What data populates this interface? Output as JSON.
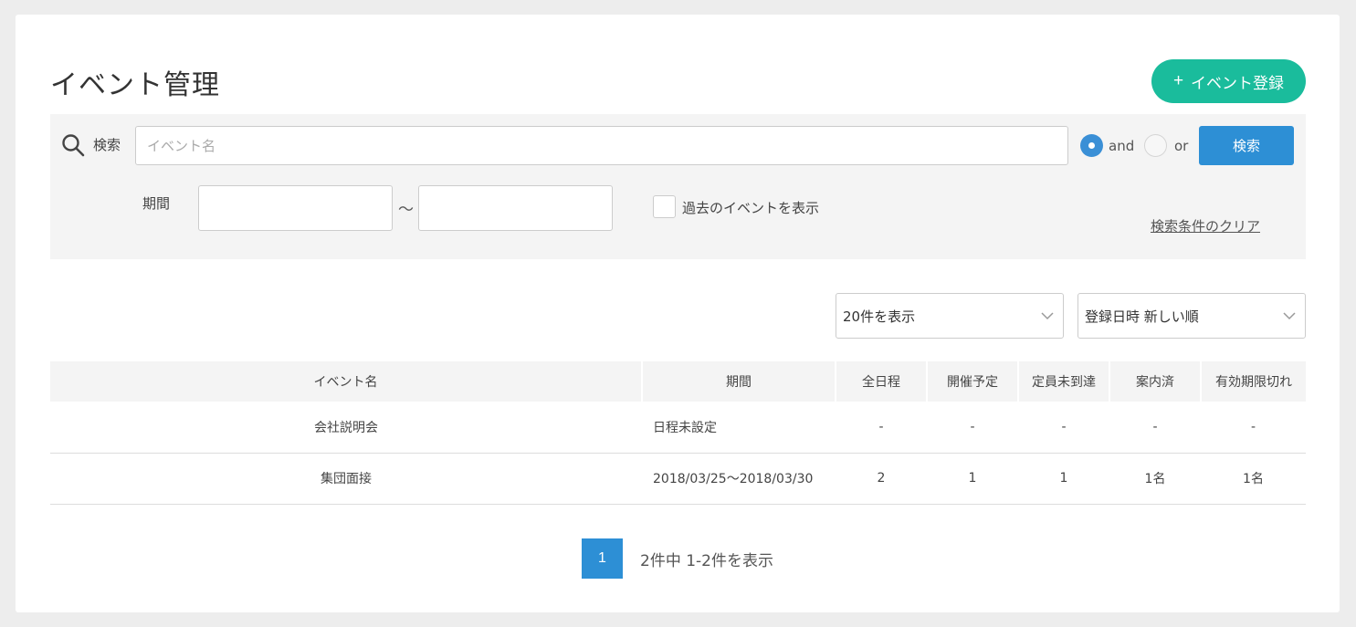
{
  "page": {
    "title": "イベント管理"
  },
  "toolbar": {
    "add_label": "イベント登録",
    "add_icon": "plus-icon"
  },
  "search": {
    "label": "検索",
    "placeholder": "イベント名",
    "value": "",
    "mode_and_label": "and",
    "mode_or_label": "or",
    "selected_mode": "and",
    "button_label": "検索",
    "period_label": "期間",
    "period_from": "",
    "period_to": "",
    "period_separator": "～",
    "show_past_label": "過去のイベントを表示",
    "show_past_checked": false,
    "clear_label": "検索条件のクリア"
  },
  "controls": {
    "per_page": "20件を表示",
    "sort": "登録日時 新しい順"
  },
  "table": {
    "headers": [
      "イベント名",
      "期間",
      "全日程",
      "開催予定",
      "定員未到達",
      "案内済",
      "有効期限切れ"
    ],
    "rows": [
      [
        "会社説明会",
        "日程未設定",
        "-",
        "-",
        "-",
        "-",
        "-"
      ],
      [
        "集団面接",
        "2018/03/25～2018/03/30",
        "2",
        "1",
        "1",
        "1名",
        "1名"
      ]
    ]
  },
  "pagination": {
    "current": "1",
    "summary": "2件中 1-2件を表示"
  },
  "colors": {
    "accent_green": "#1abc9c",
    "accent_blue": "#2d8fd5",
    "warning_red": "#d0021b"
  }
}
